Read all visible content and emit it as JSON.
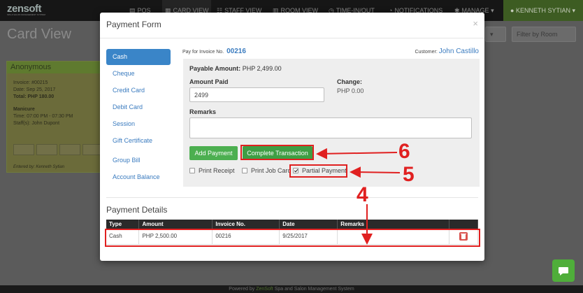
{
  "app": {
    "logo_text": "zensoft",
    "logo_tagline": "SPA & SALON MANAGEMENT SYSTEM",
    "nav": [
      "POS",
      "CARD VIEW",
      "STAFF VIEW",
      "ROOM VIEW",
      "TIME-IN/OUT",
      "NOTIFICATIONS",
      "MANAGE"
    ],
    "user": "KENNETH SYTIAN",
    "page_title": "Card View",
    "filter_label": "Filter by Room",
    "footer_prefix": "Powered by",
    "footer_brand": "ZenSoft",
    "footer_suffix": "Spa and Salon Management System"
  },
  "bg_card": {
    "title": "Anonymous",
    "invoice": "Invoice: #00215",
    "date": "Date: Sep 25, 2017",
    "total": "Total: PHP 180.00",
    "service": "Manicure",
    "time": "Time: 07:00 PM - 07:30 PM",
    "staff": "Staff(s): John Dupont",
    "entered_by": "Entered by: Kenneth Sytian"
  },
  "modal": {
    "title": "Payment Form",
    "close": "×",
    "methods": [
      "Cash",
      "Cheque",
      "Credit Card",
      "Debit Card",
      "Session",
      "Gift Certificate"
    ],
    "methods_extra": [
      "Group Bill",
      "Account Balance"
    ],
    "invoice_label": "Pay for Invoice No.",
    "invoice_no": "00216",
    "customer_label": "Customer:",
    "customer": "John Castillo",
    "payable_label": "Payable Amount:",
    "payable_value": "PHP 2,499.00",
    "amount_paid_label": "Amount Paid",
    "amount_paid_value": "2499",
    "change_label": "Change:",
    "change_value": "PHP 0.00",
    "remarks_label": "Remarks",
    "remarks_value": "",
    "add_payment": "Add Payment",
    "complete_transaction": "Complete Transaction",
    "print_receipt": "Print Receipt",
    "print_job_card": "Print Job Card",
    "partial_payment": "Partial Payment",
    "details_title": "Payment Details",
    "table_headers": [
      "Type",
      "Amount",
      "Invoice No.",
      "Date",
      "Remarks"
    ],
    "row": {
      "type": "Cash",
      "amount": "PHP 2,500.00",
      "invoice": "00216",
      "date": "9/25/2017",
      "remarks": ""
    }
  },
  "annotations": [
    "6",
    "5",
    "4"
  ],
  "colors": {
    "primary_blue": "#3a85c8",
    "success_green": "#4caf50",
    "annotation_red": "#e02020",
    "delete_red": "#d9534f"
  }
}
